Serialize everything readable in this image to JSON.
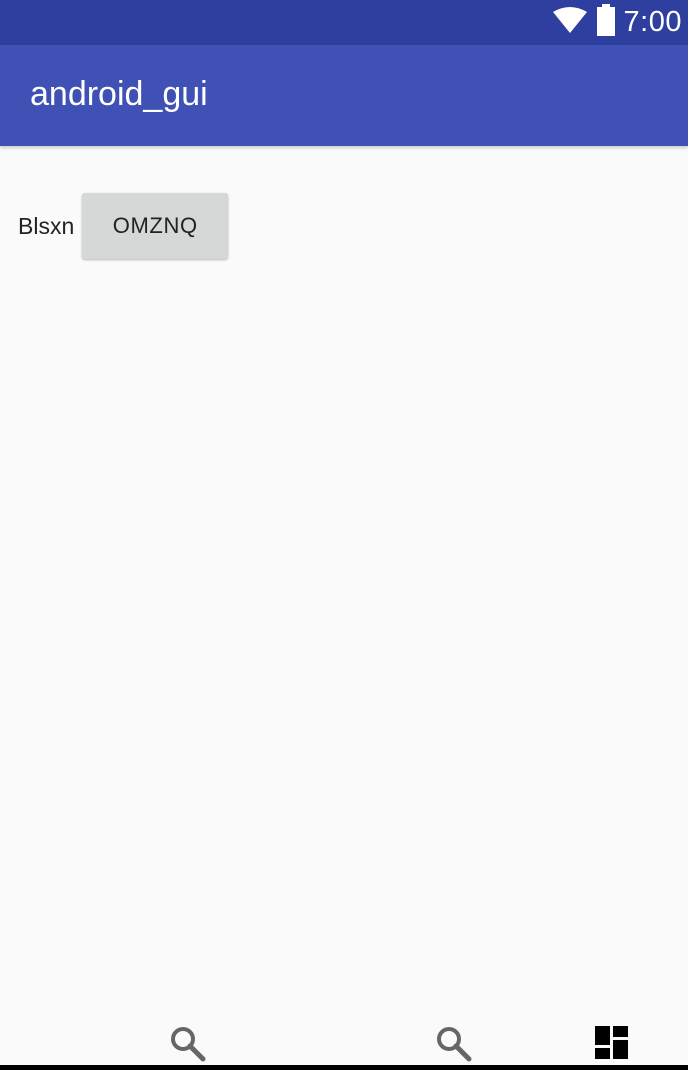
{
  "status_bar": {
    "time": "7:00",
    "icons": [
      "wifi-icon",
      "battery-icon"
    ],
    "background": "#2f3f9f"
  },
  "app_bar": {
    "title": "android_gui",
    "background": "#3f51b5"
  },
  "main": {
    "label": "Blsxn",
    "button_label": "OMZNQ"
  },
  "bottom_bar": {
    "icons": [
      "search-icon",
      "search-icon",
      "dashboard-icon"
    ]
  }
}
